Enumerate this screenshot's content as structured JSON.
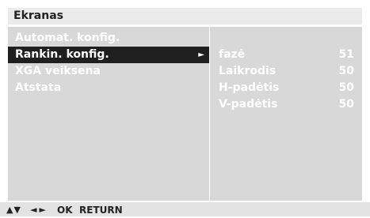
{
  "header": {
    "title": "Ekranas"
  },
  "menu": {
    "items": [
      {
        "label": "Automat. konfig."
      },
      {
        "label": "Rankin. konfig.",
        "selected": true,
        "arrow": "►"
      },
      {
        "label": "XGA veiksena"
      },
      {
        "label": "Atstata"
      }
    ]
  },
  "submenu": {
    "rows": [
      {
        "label": "fazė",
        "value": "51"
      },
      {
        "label": "Laikrodis",
        "value": "50"
      },
      {
        "label": "H-padėtis",
        "value": "50"
      },
      {
        "label": "V-padėtis",
        "value": "50"
      }
    ]
  },
  "footer": {
    "updown": "▲▼",
    "leftright": "◄►",
    "ok": "OK",
    "return": "RETURN"
  },
  "colors": {
    "title_bg": "#ebebeb",
    "panel_bg": "#d8d8d8",
    "selected_bg": "#1f1f1f",
    "text_light": "#ffffff",
    "text_dark": "#222222"
  }
}
